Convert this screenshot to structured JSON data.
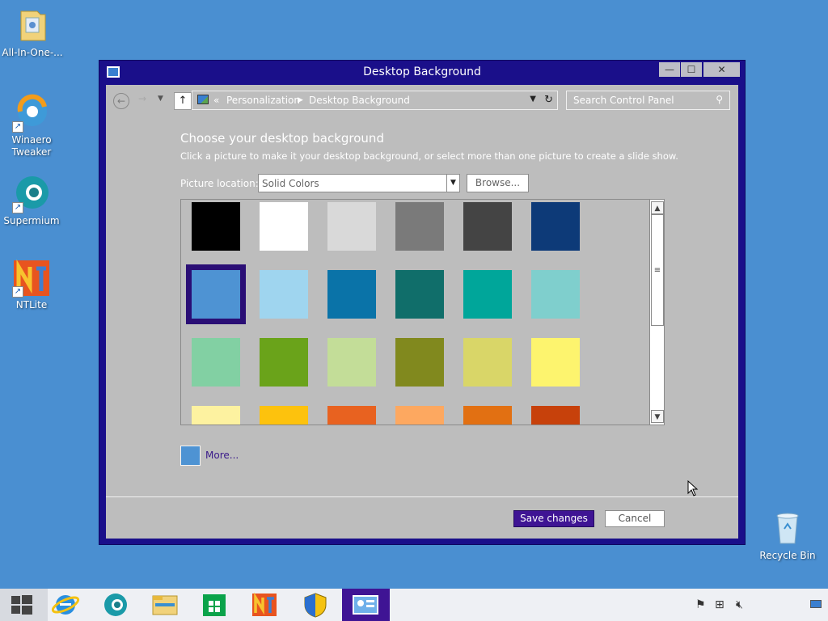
{
  "desktop": {
    "icons": [
      {
        "label": "All-In-One-..."
      },
      {
        "label": "Winaero Tweaker"
      },
      {
        "label": "Supermium"
      },
      {
        "label": "NTLite"
      },
      {
        "label": "Recycle Bin"
      }
    ]
  },
  "window": {
    "title": "Desktop Background",
    "controls": {
      "minimize": "—",
      "maximize": "☐",
      "close": "✕"
    }
  },
  "address": {
    "chevron": "«",
    "crumbs": [
      "Personalization",
      "Desktop Background"
    ],
    "separator": "▶"
  },
  "search": {
    "placeholder": "Search Control Panel"
  },
  "content": {
    "heading": "Choose your desktop background",
    "subtext": "Click a picture to make it your desktop background, or select more than one picture to create a slide show.",
    "location_label": "Picture location:",
    "location_value": "Solid Colors",
    "browse_label": "Browse...",
    "more_label": "More...",
    "more_color": "#4e93d3",
    "selected_color": "#4e93d3"
  },
  "swatches": [
    [
      "#000000",
      "#ffffff",
      "#d9d9d9",
      "#7a7a7a",
      "#444444",
      "#0d3a78"
    ],
    [
      "#4e93d3",
      "#9fd5ef",
      "#0a73a8",
      "#106e6a",
      "#00a69a",
      "#7fcfcd"
    ],
    [
      "#82d0a3",
      "#6aa31a",
      "#c3dd98",
      "#81891e",
      "#d9d668",
      "#fdf46e"
    ],
    [
      "#fdf2a0",
      "#fdc20d",
      "#e86220",
      "#fda860",
      "#e27012",
      "#c7410b"
    ]
  ],
  "buttons": {
    "save": "Save changes",
    "cancel": "Cancel"
  }
}
